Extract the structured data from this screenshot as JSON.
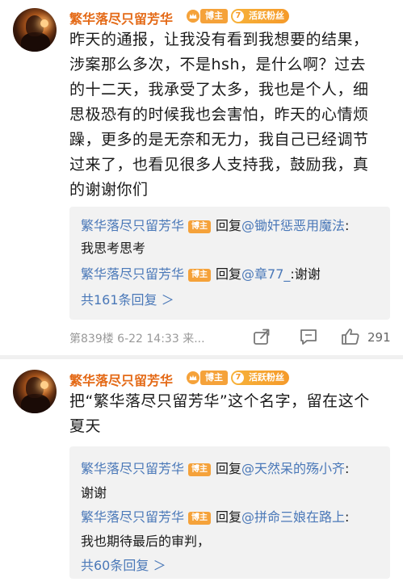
{
  "comments": [
    {
      "username": "繁华落尽只留芳华",
      "host_badge": "博主",
      "fan_badge": "活跃粉丝",
      "body_lines": [
        "昨天的通报，让我没有看到我想要的结果，",
        "涉案那么多次，不是hsh，是什么啊？过去",
        "的十二天，我承受了太多，我也是个人，细",
        "思极恐有的时候我也会害怕，昨天的心情烦",
        "躁，更多的是无奈和无力，我自己已经调节",
        "过来了，也看见很多人支持我，鼓励我，真",
        "的谢谢你们"
      ],
      "replies": [
        {
          "name": "繁华落尽只留芳华",
          "badge": "博主",
          "verb": "回复",
          "target": "@锄奸惩恶用魔法",
          "sep": ":",
          "text": "我思考思考"
        },
        {
          "name": "繁华落尽只留芳华",
          "badge": "博主",
          "verb": "回复",
          "target": "@章77_",
          "sep": ":谢谢",
          "text": ""
        }
      ],
      "more_replies": "共161条回复 ＞",
      "meta": "第839楼  6-22 14:33  来...",
      "like_count": "291"
    },
    {
      "username": "繁华落尽只留芳华",
      "host_badge": "博主",
      "fan_badge": "活跃粉丝",
      "body_lines": [
        "把“繁华落尽只留芳华”这个名字，留在这个",
        "夏天"
      ],
      "replies": [
        {
          "name": "繁华落尽只留芳华",
          "badge": "博主",
          "verb": "回复",
          "target": "@天然呆的殇小齐",
          "sep": ":",
          "text": "谢谢"
        },
        {
          "name": "繁华落尽只留芳华",
          "badge": "博主",
          "verb": "回复",
          "target": "@拼命三娘在路上",
          "sep": ":",
          "text": "我也期待最后的审判，"
        }
      ],
      "more_replies": "共60条回复 ＞"
    }
  ],
  "icons": {
    "crown": "crown-badge-icon",
    "share": "share-icon",
    "comment": "comment-icon",
    "like": "thumbs-up-icon"
  },
  "colors": {
    "username": "#e46a17",
    "link": "#4a78b8",
    "host_badge": "#f5a23a",
    "reply_bg": "#f2f2f2"
  }
}
